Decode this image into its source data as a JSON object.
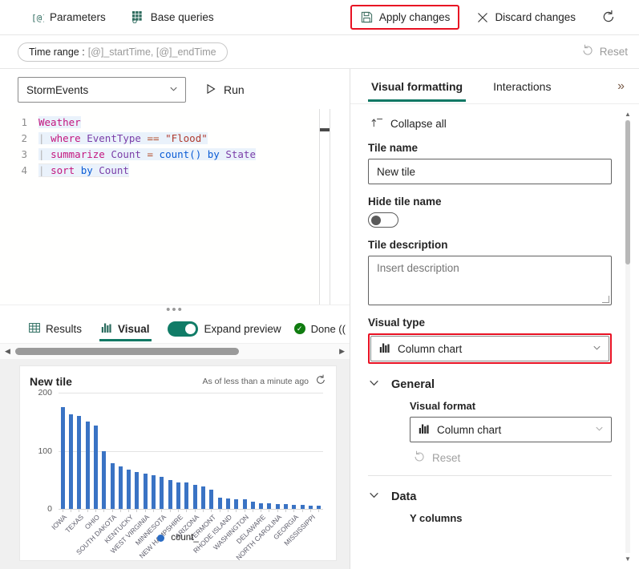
{
  "toolbar": {
    "parameters_label": "Parameters",
    "parameters_icon": "at-brackets-icon",
    "base_queries_label": "Base queries",
    "base_queries_icon": "grid-icon",
    "apply_label": "Apply changes",
    "apply_icon": "save-icon",
    "discard_label": "Discard changes",
    "discard_icon": "close-icon",
    "refresh_icon": "refresh-icon",
    "highlight_color": "#e81123"
  },
  "timebar": {
    "time_range_label": "Time range :",
    "time_range_value": "[@]_startTime, [@]_endTime",
    "reset_label": "Reset",
    "reset_icon": "undo-icon"
  },
  "query": {
    "table_selected": "StormEvents",
    "run_label": "Run",
    "run_icon": "play-icon",
    "lines": [
      {
        "n": "1",
        "tokens": [
          {
            "t": "Weather",
            "c": "k-table"
          }
        ]
      },
      {
        "n": "2",
        "tokens": [
          {
            "t": "| ",
            "c": "k-pipe"
          },
          {
            "t": "where ",
            "c": "k-kw"
          },
          {
            "t": "EventType ",
            "c": "k-col"
          },
          {
            "t": "== ",
            "c": "k-op"
          },
          {
            "t": "\"Flood\"",
            "c": "k-str"
          }
        ]
      },
      {
        "n": "3",
        "tokens": [
          {
            "t": "| ",
            "c": "k-pipe"
          },
          {
            "t": "summarize ",
            "c": "k-kw"
          },
          {
            "t": "Count ",
            "c": "k-col"
          },
          {
            "t": "= ",
            "c": "k-op"
          },
          {
            "t": "count() ",
            "c": "k-fn"
          },
          {
            "t": "by ",
            "c": "k-by"
          },
          {
            "t": "State",
            "c": "k-col"
          }
        ]
      },
      {
        "n": "4",
        "tokens": [
          {
            "t": "| ",
            "c": "k-pipe"
          },
          {
            "t": "sort ",
            "c": "k-kw"
          },
          {
            "t": "by ",
            "c": "k-by"
          },
          {
            "t": "Count",
            "c": "k-col"
          }
        ]
      }
    ]
  },
  "results": {
    "tabs": [
      {
        "label": "Results",
        "icon": "table-icon",
        "active": false
      },
      {
        "label": "Visual",
        "icon": "chart-icon",
        "active": true
      }
    ],
    "expand_preview_label": "Expand preview",
    "expand_preview_on": true,
    "status_label": "Done ((",
    "status_icon": "check-circle-icon"
  },
  "tile": {
    "title": "New tile",
    "as_of": "As of less than a minute ago",
    "refresh_icon": "refresh-icon"
  },
  "chart_data": {
    "type": "bar",
    "title": "New tile",
    "xlabel": "",
    "ylabel": "",
    "ylim": [
      0,
      200
    ],
    "yticks": [
      0,
      100,
      200
    ],
    "grid": true,
    "legend": [
      "count_"
    ],
    "legend_position": "bottom",
    "series_color": "#3a73c4",
    "categories": [
      "IOWA",
      "",
      "TEXAS",
      "",
      "OHIO",
      "",
      "SOUTH DAKOTA",
      "",
      "KENTUCKY",
      "",
      "WEST VIRGINIA",
      "",
      "MINNESOTA",
      "",
      "NEW HAMPSHIRE",
      "",
      "ARIZONA",
      "",
      "VERMONT",
      "",
      "RHODE ISLAND",
      "",
      "WASHINGTON",
      "",
      "DELAWARE",
      "",
      "NORTH CAROLINA",
      "",
      "GEORGIA",
      "",
      "MISSISSIPPI",
      ""
    ],
    "tick_labels": [
      "IOWA",
      "TEXAS",
      "OHIO",
      "SOUTH DAKOTA",
      "KENTUCKY",
      "WEST VIRGINIA",
      "MINNESOTA",
      "NEW HAMPSHIRE",
      "ARIZONA",
      "VERMONT",
      "RHODE ISLAND",
      "WASHINGTON",
      "DELAWARE",
      "NORTH CAROLINA",
      "GEORGIA",
      "MISSISSIPPI"
    ],
    "series": [
      {
        "name": "count_",
        "values": [
          175,
          163,
          160,
          150,
          144,
          99,
          78,
          73,
          68,
          64,
          61,
          58,
          55,
          50,
          46,
          45,
          42,
          38,
          33,
          20,
          18,
          17,
          16,
          13,
          10,
          9,
          8,
          8,
          7,
          7,
          6,
          5
        ]
      }
    ]
  },
  "panel": {
    "tabs": [
      {
        "label": "Visual formatting",
        "active": true
      },
      {
        "label": "Interactions",
        "active": false
      }
    ],
    "expand_icon": "double-chevron-right-icon",
    "collapse_all_label": "Collapse all",
    "collapse_all_icon": "collapse-icon",
    "tile_name_label": "Tile name",
    "tile_name_value": "New tile",
    "hide_tile_name_label": "Hide tile name",
    "hide_tile_name_on": false,
    "tile_description_label": "Tile description",
    "tile_description_placeholder": "Insert description",
    "visual_type_label": "Visual type",
    "visual_type_value": "Column chart",
    "visual_type_icon": "chart-icon",
    "visual_type_highlight": "#e81123",
    "general_section_label": "General",
    "visual_format_label": "Visual format",
    "visual_format_value": "Column chart",
    "visual_format_icon": "chart-icon",
    "reset_label": "Reset",
    "reset_icon": "undo-icon",
    "data_section_label": "Data",
    "y_columns_label": "Y columns"
  }
}
